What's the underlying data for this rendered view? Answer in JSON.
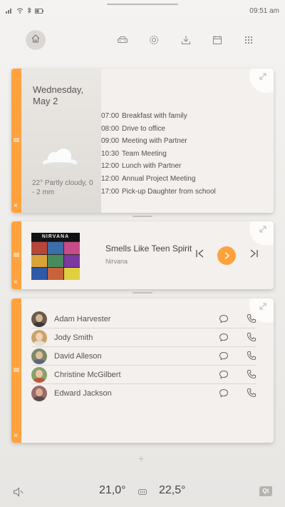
{
  "status": {
    "time": "09:51 am",
    "icons": [
      "signal-icon",
      "wifi-icon",
      "bluetooth-icon",
      "battery-icon"
    ]
  },
  "nav": {
    "items": [
      "home-icon",
      "car-icon",
      "settings-icon",
      "download-icon",
      "calendar-icon",
      "apps-grid-icon"
    ]
  },
  "calendar": {
    "date": "Wednesday, May 2",
    "weather": "22° Partly cloudy, 0 - 2 mm",
    "events": [
      {
        "time": "07:00",
        "title": "Breakfast with family"
      },
      {
        "time": "08:00",
        "title": "Drive to office"
      },
      {
        "time": "09:00",
        "title": "Meeting with Partner"
      },
      {
        "time": "10:30",
        "title": "Team Meeting"
      },
      {
        "time": "12:00",
        "title": "Lunch with Partner"
      },
      {
        "time": "12:00",
        "title": "Annual Project Meeting"
      },
      {
        "time": "17:00",
        "title": "Pick-up Daughter from school"
      }
    ]
  },
  "music": {
    "album_label": "NIRVANA",
    "track": "Smells Like Teen Spirit",
    "artist": "Nirvana"
  },
  "contacts": [
    {
      "name": "Adam Harvester"
    },
    {
      "name": "Jody Smith"
    },
    {
      "name": "David Alleson"
    },
    {
      "name": "Christine McGilbert"
    },
    {
      "name": "Edward Jackson"
    }
  ],
  "climate": {
    "left_temp": "21,0°",
    "right_temp": "22,5°",
    "logo": "Qt"
  },
  "colors": {
    "accent": "#ffa23d",
    "card": "#f3f0ed",
    "background": "#ebe9e6"
  }
}
